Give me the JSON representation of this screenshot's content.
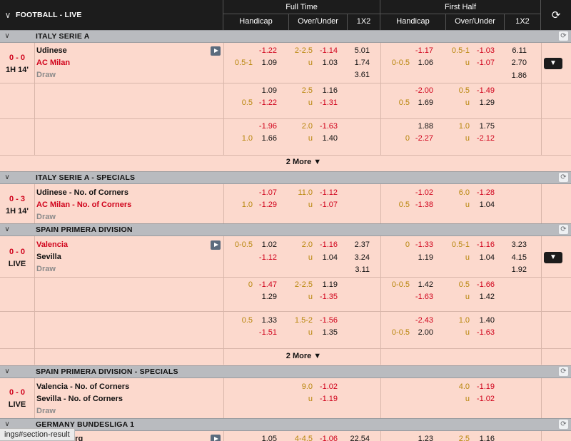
{
  "header": {
    "title": "FOOTBALL - LIVE",
    "full_time": "Full Time",
    "first_half": "First Half",
    "handicap": "Handicap",
    "over_under": "Over/Under",
    "x12": "1X2",
    "refresh": "⟳"
  },
  "sections": {
    "s1": "ITALY SERIE A",
    "s2": "ITALY SERIE A - SPECIALS",
    "s3": "SPAIN PRIMERA DIVISION",
    "s4": "SPAIN PRIMERA DIVISION - SPECIALS",
    "s5": "GERMANY BUNDESLIGA 1"
  },
  "m1": {
    "score": "0 - 0",
    "time": "1H 14'",
    "home": "Udinese",
    "away": "AC Milan",
    "draw": "Draw",
    "r1": {
      "ft_hdp_h": "",
      "ft_hdp_o": "-1.22",
      "ft_ou_l": "2-2.5",
      "ft_ou_o": "-1.14",
      "ft_x": "5.01",
      "fh_hdp_h": "",
      "fh_hdp_o": "-1.17",
      "fh_ou_l": "0.5-1",
      "fh_ou_o": "-1.03",
      "fh_x": "6.11"
    },
    "r2": {
      "ft_hdp_h": "0.5-1",
      "ft_hdp_o": "1.09",
      "ft_ou_l": "u",
      "ft_ou_o": "1.03",
      "ft_x": "1.74",
      "fh_hdp_h": "0-0.5",
      "fh_hdp_o": "1.06",
      "fh_ou_l": "u",
      "fh_ou_o": "-1.07",
      "fh_x": "2.70"
    },
    "r3": {
      "ft_x": "3.61",
      "fh_x": "1.86"
    },
    "e1": {
      "a": {
        "ft_hdp_o": "1.09",
        "ft_ou_l": "2.5",
        "ft_ou_o": "1.16",
        "fh_hdp_o": "-2.00",
        "fh_ou_l": "0.5",
        "fh_ou_o": "-1.49"
      },
      "b": {
        "ft_hdp_h": "0.5",
        "ft_hdp_o": "-1.22",
        "ft_ou_l": "u",
        "ft_ou_o": "-1.31",
        "fh_hdp_h": "0.5",
        "fh_hdp_o": "1.69",
        "fh_ou_l": "u",
        "fh_ou_o": "1.29"
      }
    },
    "e2": {
      "a": {
        "ft_hdp_o": "-1.96",
        "ft_ou_l": "2.0",
        "ft_ou_o": "-1.63",
        "fh_hdp_o": "1.88",
        "fh_ou_l": "1.0",
        "fh_ou_o": "1.75"
      },
      "b": {
        "ft_hdp_h": "1.0",
        "ft_hdp_o": "1.66",
        "ft_ou_l": "u",
        "ft_ou_o": "1.40",
        "fh_hdp_h": "0",
        "fh_hdp_o": "-2.27",
        "fh_ou_l": "u",
        "fh_ou_o": "-2.12"
      }
    },
    "more": "2 More ▼"
  },
  "m2": {
    "score": "0 - 3",
    "time": "1H 14'",
    "home": "Udinese - No. of Corners",
    "away": "AC Milan - No. of Corners",
    "draw": "Draw",
    "r1": {
      "ft_hdp_o": "-1.07",
      "ft_ou_l": "11.0",
      "ft_ou_o": "-1.12",
      "fh_hdp_o": "-1.02",
      "fh_ou_l": "6.0",
      "fh_ou_o": "-1.28"
    },
    "r2": {
      "ft_hdp_h": "1.0",
      "ft_hdp_o": "-1.29",
      "ft_ou_l": "u",
      "ft_ou_o": "-1.07",
      "fh_hdp_h": "0.5",
      "fh_hdp_o": "-1.38",
      "fh_ou_l": "u",
      "fh_ou_o": "1.04"
    }
  },
  "m3": {
    "score": "0 - 0",
    "time": "LIVE",
    "home": "Valencia",
    "away": "Sevilla",
    "draw": "Draw",
    "r1": {
      "ft_hdp_h": "0-0.5",
      "ft_hdp_o": "1.02",
      "ft_ou_l": "2.0",
      "ft_ou_o": "-1.16",
      "ft_x": "2.37",
      "fh_hdp_h": "0",
      "fh_hdp_o": "-1.33",
      "fh_ou_l": "0.5-1",
      "fh_ou_o": "-1.16",
      "fh_x": "3.23"
    },
    "r2": {
      "ft_hdp_o": "-1.12",
      "ft_ou_l": "u",
      "ft_ou_o": "1.04",
      "ft_x": "3.24",
      "fh_hdp_o": "1.19",
      "fh_ou_l": "u",
      "fh_ou_o": "1.04",
      "fh_x": "4.15"
    },
    "r3": {
      "ft_x": "3.11",
      "fh_x": "1.92"
    },
    "e1": {
      "a": {
        "ft_hdp_h": "0",
        "ft_hdp_o": "-1.47",
        "ft_ou_l": "2-2.5",
        "ft_ou_o": "1.19",
        "fh_hdp_h": "0-0.5",
        "fh_hdp_o": "1.42",
        "fh_ou_l": "0.5",
        "fh_ou_o": "-1.66"
      },
      "b": {
        "ft_hdp_o": "1.29",
        "ft_ou_l": "u",
        "ft_ou_o": "-1.35",
        "fh_hdp_o": "-1.63",
        "fh_ou_l": "u",
        "fh_ou_o": "1.42"
      }
    },
    "e2": {
      "a": {
        "ft_hdp_h": "0.5",
        "ft_hdp_o": "1.33",
        "ft_ou_l": "1.5-2",
        "ft_ou_o": "-1.56",
        "fh_hdp_o": "-2.43",
        "fh_ou_l": "1.0",
        "fh_ou_o": "1.40"
      },
      "b": {
        "ft_hdp_o": "-1.51",
        "ft_ou_l": "u",
        "ft_ou_o": "1.35",
        "fh_hdp_h": "0-0.5",
        "fh_hdp_o": "2.00",
        "fh_ou_l": "u",
        "fh_ou_o": "-1.63"
      }
    },
    "more": "2 More ▼"
  },
  "m4": {
    "score": "0 - 0",
    "time": "LIVE",
    "home": "Valencia - No. of Corners",
    "away": "Sevilla - No. of Corners",
    "draw": "Draw",
    "r1": {
      "ft_ou_l": "9.0",
      "ft_ou_o": "-1.02",
      "fh_ou_l": "4.0",
      "fh_ou_o": "-1.19"
    },
    "r2": {
      "ft_ou_l": "u",
      "ft_ou_o": "-1.19",
      "fh_ou_l": "u",
      "fh_ou_o": "-1.02"
    }
  },
  "m5": {
    "home": "...rg",
    "r1": {
      "ft_hdp_o": "1.05",
      "ft_ou_l": "4-4.5",
      "ft_ou_o": "-1.06",
      "ft_x": "22.54",
      "fh_hdp_o": "1.23",
      "fh_ou_l": "2.5",
      "fh_ou_o": "1.16"
    }
  },
  "icons": {
    "expand": "▼",
    "chevron": "∨"
  },
  "statusbar": "ings#section-result"
}
